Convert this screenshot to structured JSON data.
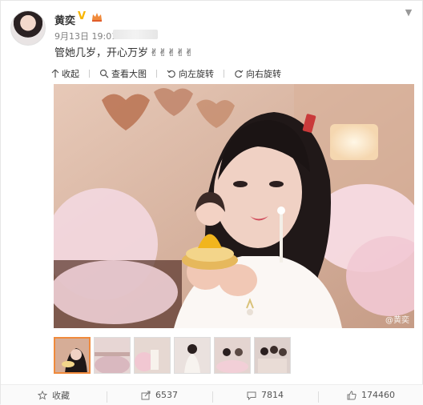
{
  "post": {
    "author": "黄奕",
    "timestamp": "9月13日 19:01",
    "text": "管她几岁，开心万岁",
    "emojis": "✌✌✌✌✌",
    "watermark": "@黄奕"
  },
  "toolbar": {
    "collapse": "收起",
    "view_large": "查看大图",
    "rotate_left": "向左旋转",
    "rotate_right": "向右旋转"
  },
  "thumbnails": {
    "count": 6,
    "selected_index": 0
  },
  "footer": {
    "favorite": "收藏",
    "reposts": "6537",
    "comments": "7814",
    "likes": "174460"
  },
  "colors": {
    "accent": "#f08a3b",
    "badge": "#f7b500",
    "text": "#333333",
    "meta": "#808080"
  }
}
